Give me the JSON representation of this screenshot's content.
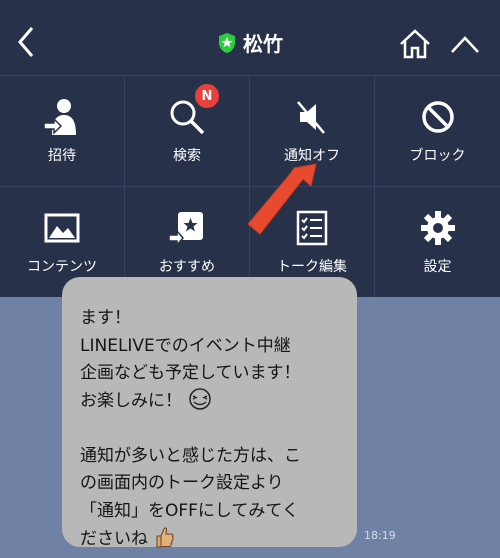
{
  "header": {
    "title": "松竹"
  },
  "menu": {
    "items": [
      {
        "label": "招待",
        "icon": "invite-icon"
      },
      {
        "label": "検索",
        "icon": "search-icon",
        "badge": "N"
      },
      {
        "label": "通知オフ",
        "icon": "mute-icon"
      },
      {
        "label": "ブロック",
        "icon": "block-icon"
      },
      {
        "label": "コンテンツ",
        "icon": "image-icon"
      },
      {
        "label": "おすすめ",
        "icon": "recommend-icon"
      },
      {
        "label": "トーク編集",
        "icon": "edit-list-icon"
      },
      {
        "label": "設定",
        "icon": "gear-icon"
      }
    ]
  },
  "chat": {
    "message_lines": [
      "ます！",
      "LINELIVEでのイベント中継",
      "企画なども予定しています！",
      "お楽しみに！",
      "",
      "通知が多いと感じた方は、こ",
      "の画面内のトーク設定より",
      "「通知」をOFFにしてみてく",
      "ださいね"
    ],
    "time": "18:19"
  },
  "colors": {
    "header_bg": "#27324a",
    "chat_bg": "#6f82a6",
    "badge": "#e8403a",
    "arrow": "#e84a2f",
    "verified": "#2ecc40"
  }
}
